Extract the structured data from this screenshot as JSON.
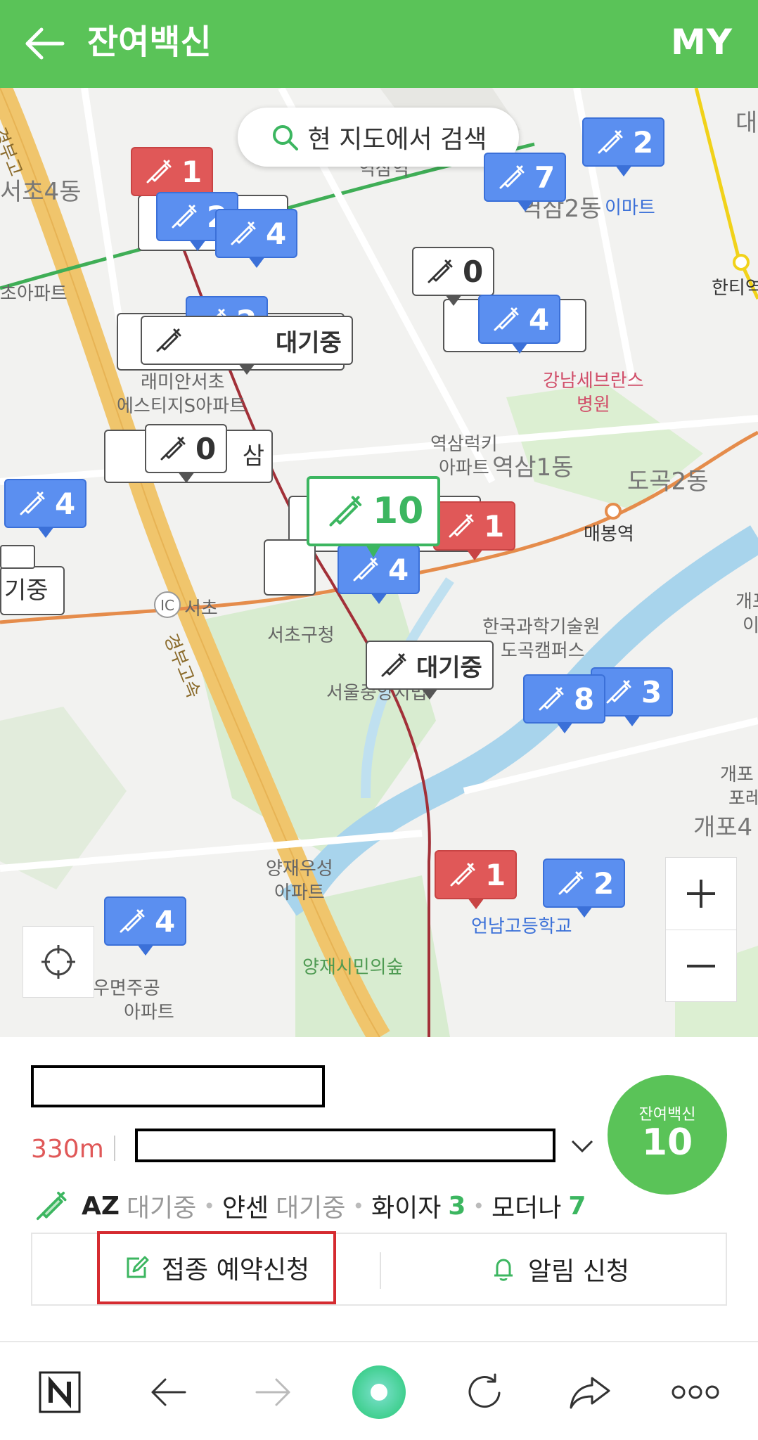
{
  "header": {
    "title": "잔여백신",
    "my_label": "MY"
  },
  "map": {
    "search_label": "현 지도에서 검색",
    "labels": {
      "seocho4dong": "서초4동",
      "apartment_left": "초아파트",
      "raemian_1": "래미안서초",
      "raemian_2": "에스티지S아파트",
      "yeoksam_lucky_1": "역삼럭키",
      "yeoksam_lucky_2": "아파트",
      "yeoksam1dong": "역삼1동",
      "dogok2dong": "도곡2동",
      "maebong": "매봉역",
      "gangnam_severance_1": "강남세브란스",
      "gangnam_severance_2": "병원",
      "yeoksam2dong": "역삼2동",
      "emart": "이마트",
      "hanti": "한티역",
      "kaist_1": "한국과학기술원",
      "kaist_2": "도곡캠퍼스",
      "seocho_office": "서초구청",
      "seoul_court": "서울중앙지법",
      "yangjae_woosung_1": "양재우성",
      "yangjae_woosung_2": "아파트",
      "yangjae_forest": "양재시민의숲",
      "eonnam_school": "언남고등학교",
      "umyeon_1": "우면주공",
      "umyeon_2": "아파트",
      "ic_seocho": "서초",
      "gaepo4": "개포4",
      "gaepo_1": "개포",
      "gaepo_2": "포레",
      "yeoksam_station": "역삼역",
      "gyeongbu_1": "경부고",
      "gyeongbu_2": "경부고속",
      "dae_top": "대",
      "gae_right": "개포",
      "i_right": "이",
      "daegijung_partial": "기중",
      "waiting_partial": "대기중",
      "sam_partial": "삼"
    },
    "markers": [
      {
        "id": "m1",
        "kind": "red",
        "label": "1"
      },
      {
        "id": "m2",
        "kind": "blue",
        "label": "2"
      },
      {
        "id": "m3",
        "kind": "blue",
        "label": "4"
      },
      {
        "id": "m4",
        "kind": "blue",
        "label": "7"
      },
      {
        "id": "m5",
        "kind": "blue",
        "label": "2"
      },
      {
        "id": "m6",
        "kind": "white",
        "label": "0"
      },
      {
        "id": "m7",
        "kind": "blue",
        "label": "4"
      },
      {
        "id": "m8",
        "kind": "blue",
        "label": "2"
      },
      {
        "id": "m9",
        "kind": "white",
        "label": "대기중"
      },
      {
        "id": "m10",
        "kind": "white",
        "label": "0"
      },
      {
        "id": "m11",
        "kind": "blue",
        "label": "4"
      },
      {
        "id": "m12",
        "kind": "green",
        "label": "10"
      },
      {
        "id": "m13",
        "kind": "red",
        "label": "1"
      },
      {
        "id": "m14",
        "kind": "blue",
        "label": "4"
      },
      {
        "id": "m15",
        "kind": "white",
        "label": "대기중"
      },
      {
        "id": "m16",
        "kind": "blue",
        "label": "8"
      },
      {
        "id": "m17",
        "kind": "blue",
        "label": "3"
      },
      {
        "id": "m18",
        "kind": "red",
        "label": "1"
      },
      {
        "id": "m19",
        "kind": "blue",
        "label": "2"
      },
      {
        "id": "m20",
        "kind": "blue",
        "label": "4"
      },
      {
        "id": "m21",
        "kind": "white",
        "label": "기중"
      }
    ]
  },
  "panel": {
    "distance": "330m",
    "count_label": "잔여백신",
    "count_value": "10",
    "vaccines": [
      {
        "name": "AZ",
        "status": "대기중"
      },
      {
        "name": "얀센",
        "status": "대기중"
      },
      {
        "name": "화이자",
        "status": "3"
      },
      {
        "name": "모더나",
        "status": "7"
      }
    ],
    "reserve_label": "접종 예약신청",
    "alarm_label": "알림 신청"
  },
  "colors": {
    "brand_green": "#5ac358",
    "marker_blue": "#5b8ff0",
    "marker_red": "#e05858",
    "highlight_red": "#d52b30"
  }
}
